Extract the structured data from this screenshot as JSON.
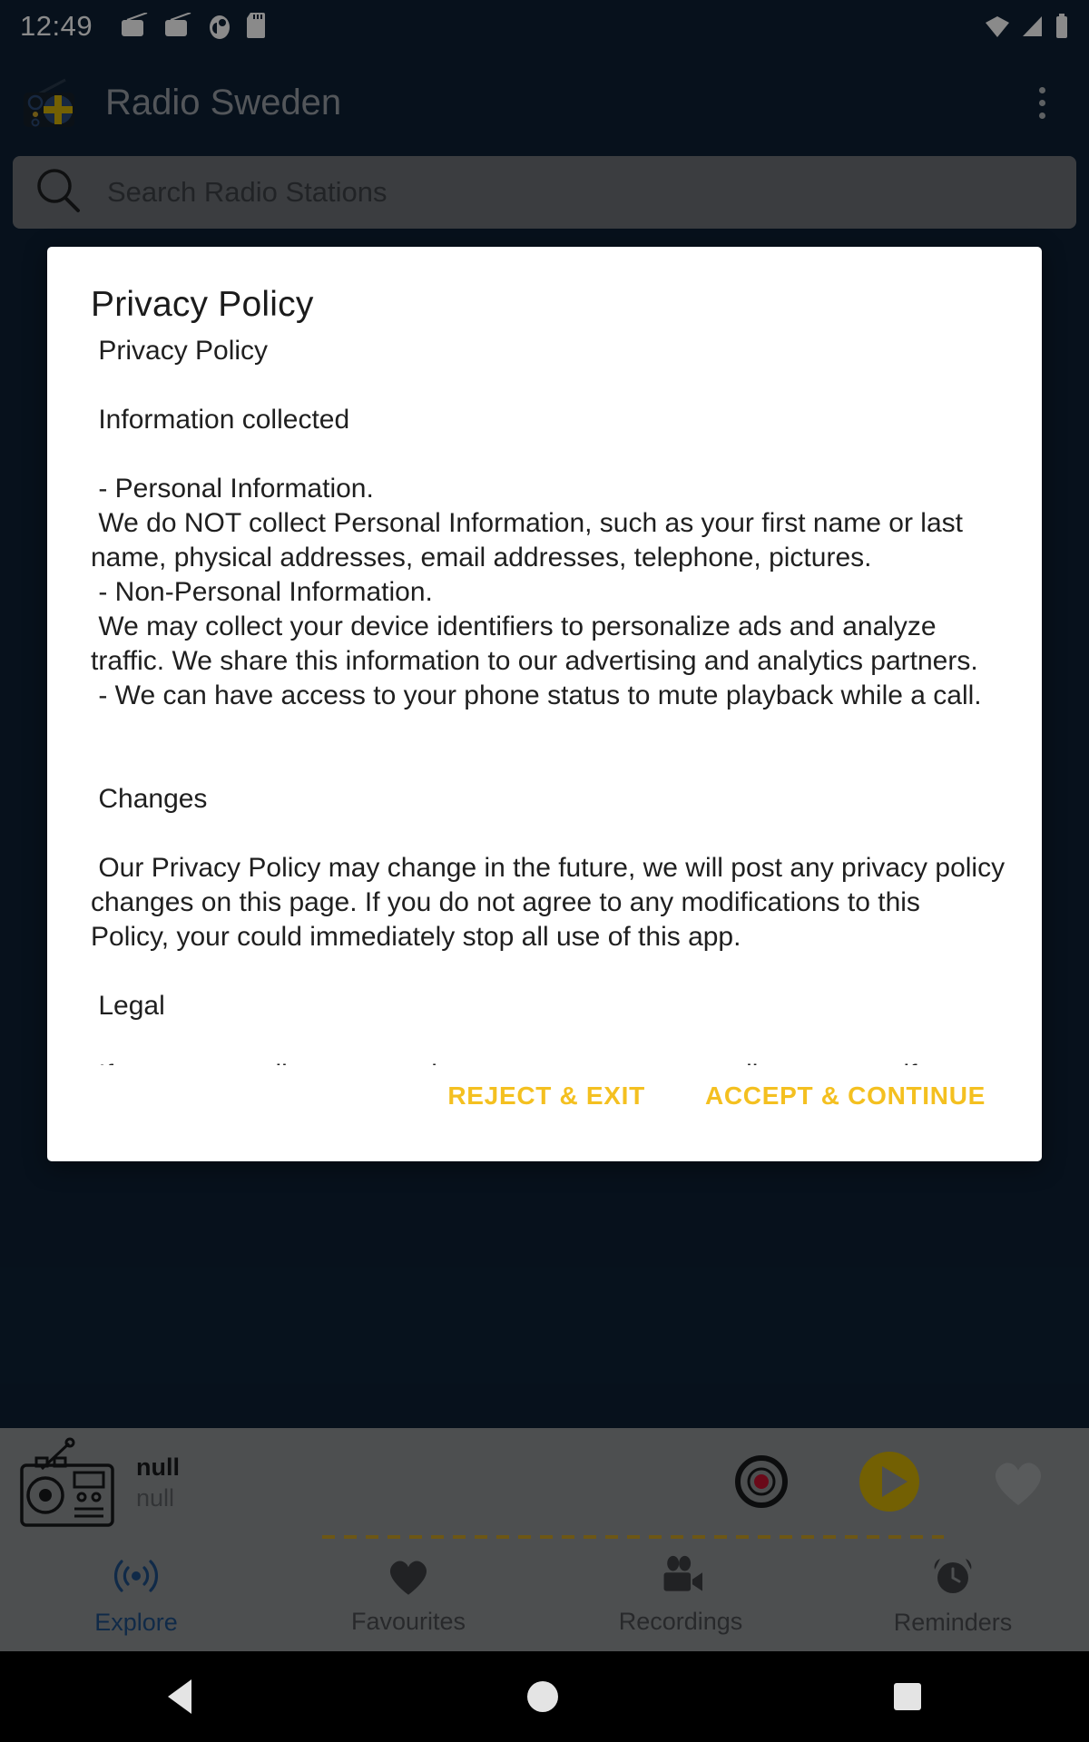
{
  "status_bar": {
    "time": "12:49",
    "left_icons": [
      "radio-notification-icon",
      "radio-notification-icon",
      "app-notification-icon",
      "sd-card-icon"
    ],
    "right_icons": [
      "wifi-icon",
      "cellular-signal-icon",
      "battery-icon"
    ]
  },
  "app_bar": {
    "title": "Radio Sweden",
    "icon": "radio-sweden-app-icon",
    "overflow_icon": "overflow-menu-icon"
  },
  "search": {
    "placeholder": "Search Radio Stations",
    "value": "",
    "icon": "search-icon"
  },
  "dialog": {
    "title": "Privacy Policy",
    "body": " Privacy Policy\n\n Information collected\n\n - Personal Information.\n We do NOT collect Personal Information, such as your first name or last name, physical addresses, email addresses, telephone, pictures.\n - Non-Personal Information.\n We may collect your device identifiers to personalize ads and analyze traffic. We share this information to our advertising and analytics partners.\n - We can have access to your phone status to mute playback while a call.\n\n\n Changes\n\n Our Privacy Policy may change in the future, we will post any privacy policy changes on this page. If you do not agree to any modifications to this Policy, your could immediately stop all use of this app.\n\n Legal\n\n If you are a radio owner and you want to remove a radio stream or if you have any question regarding this app, please send an email to info@nodemtech.com",
    "reject_label": "REJECT & EXIT",
    "accept_label": "ACCEPT & CONTINUE",
    "button_color": "#f4c020"
  },
  "now_playing": {
    "icon": "radio-placeholder-icon",
    "title": "null",
    "subtitle": "null",
    "record_icon": "record-icon",
    "play_icon": "play-icon",
    "favourite_icon": "heart-icon",
    "progress_color": "#c9a227"
  },
  "bottom_nav": {
    "items": [
      {
        "label": "Explore",
        "icon": "broadcast-icon",
        "active": true
      },
      {
        "label": "Favourites",
        "icon": "heart-icon",
        "active": false
      },
      {
        "label": "Recordings",
        "icon": "video-camera-icon",
        "active": false
      },
      {
        "label": "Reminders",
        "icon": "alarm-clock-icon",
        "active": false
      }
    ],
    "active_color": "#1f4f86",
    "inactive_color": "#4a4d51"
  },
  "system_nav": {
    "back": "back-icon",
    "home": "home-icon",
    "recents": "recents-icon"
  }
}
